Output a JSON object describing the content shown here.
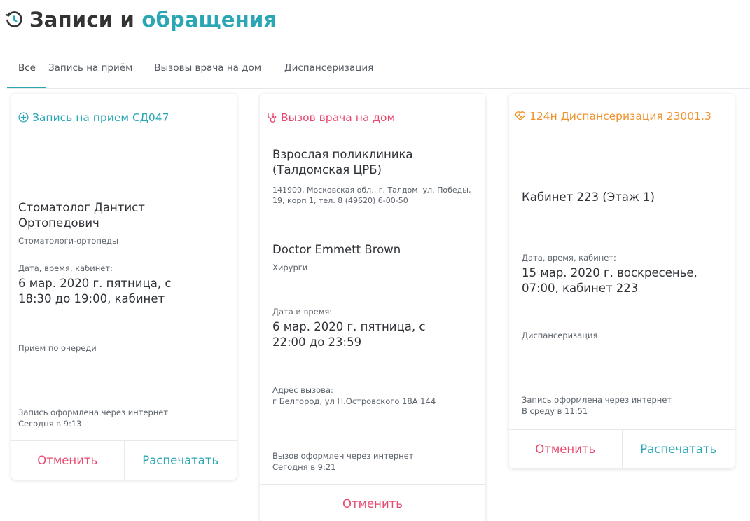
{
  "header": {
    "title_part1": "Записи и",
    "title_part2": "обращения"
  },
  "tabs": [
    {
      "label": "Все",
      "active": true
    },
    {
      "label": "Запись на приём",
      "active": false
    },
    {
      "label": "Вызовы врача на дом",
      "active": false
    },
    {
      "label": "Диспансеризация",
      "active": false
    }
  ],
  "cards": {
    "appointment": {
      "title": "Запись на прием СД047",
      "doctor": "Стоматолог Дантист Ортопедович",
      "specialty": "Стоматологи-ортопеды",
      "datetime_label": "Дата, время, кабинет:",
      "datetime": "6 мар. 2020 г. пятница, с 18:30 до 19:00, кабинет",
      "queue_note": "Прием по очереди",
      "created_via": "Запись оформлена через интернет",
      "created_at": "Сегодня в 9:13",
      "cancel_label": "Отменить",
      "print_label": "Распечатать"
    },
    "home_call": {
      "title": "Вызов врача на дом",
      "clinic": "Взрослая поликлиника (Талдомская ЦРБ)",
      "clinic_address": "141900, Московская обл., г. Талдом, ул. Победы, 19, корп 1, тел. 8 (49620) 6-00-50",
      "doctor": "Doctor Emmett Brown",
      "specialty": "Хирурги",
      "datetime_label": "Дата и время:",
      "datetime": "6 мар. 2020 г. пятница, с 22:00 до 23:59",
      "address_label": "Адрес вызова:",
      "address": "г Белгород, ул Н.Островского 18А 144",
      "created_via": "Вызов оформлен через интернет",
      "created_at": "Сегодня в 9:21",
      "cancel_label": "Отменить"
    },
    "dispensary": {
      "title": "124н Диспансеризация 23001.3",
      "room": "Кабинет 223 (Этаж 1)",
      "datetime_label": "Дата, время, кабинет:",
      "datetime": "15 мар. 2020 г. воскресенье, 07:00, кабинет 223",
      "type": "Диспансеризация",
      "created_via": "Запись оформлена через интернет",
      "created_at": "В среду в 11:51",
      "cancel_label": "Отменить",
      "print_label": "Распечатать"
    }
  },
  "colors": {
    "accent": "#2aa6b5",
    "pink": "#e84a6f",
    "orange": "#f0912c"
  },
  "icons": [
    "history-icon",
    "plus-circle-icon",
    "stethoscope-icon",
    "heart-pulse-icon"
  ]
}
